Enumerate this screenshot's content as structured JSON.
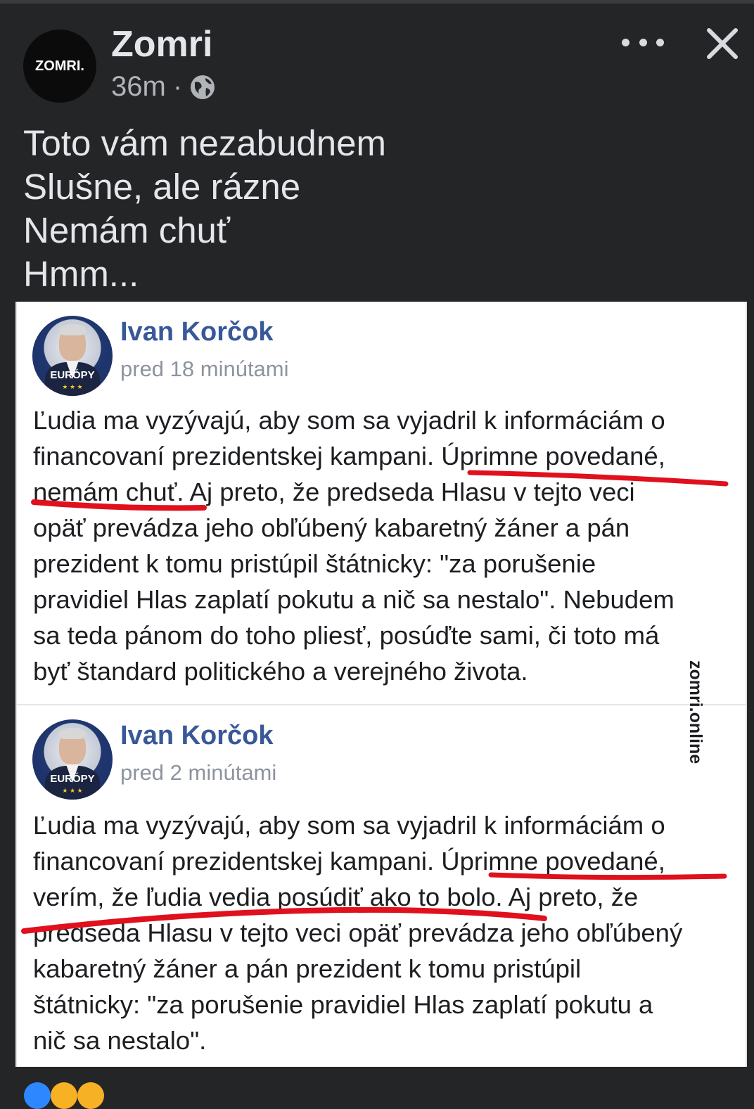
{
  "post": {
    "page_name": "Zomri",
    "avatar_text": "ZOMRI.",
    "time": "36m",
    "separator": "·",
    "privacy_icon": "globe-icon",
    "caption_lines": [
      "Toto vám nezabudnem",
      "Slušne, ale rázne",
      "Nemám chuť",
      "Hmm..."
    ]
  },
  "screenshot": {
    "watermark": "zomri.online",
    "posts": [
      {
        "author": "Ivan Korčok",
        "avatar_badge": "EURÓPY",
        "time": "pred 18 minútami",
        "lines": [
          "Ľudia ma vyzývajú, aby som sa vyjadril k informáciám o",
          "financovaní prezidentskej kampani. Úprimne povedané,",
          "nemám chuť. Aj preto, že predseda Hlasu v tejto veci",
          "opäť prevádza jeho obľúbený kabaretný žáner a pán",
          "prezident k tomu pristúpil štátnicky: \"za porušenie",
          "pravidiel Hlas zaplatí pokutu a nič sa nestalo\". Nebudem",
          "sa teda pánom do toho pliesť, posúďte sami, či toto má",
          "byť štandard politického a verejného života."
        ]
      },
      {
        "author": "Ivan Korčok",
        "avatar_badge": "EURÓPY",
        "time": "pred 2 minútami",
        "lines": [
          "Ľudia ma vyzývajú, aby som sa vyjadril k informáciám o",
          "financovaní prezidentskej kampani. Úprimne povedané,",
          "verím, že ľudia vedia posúdiť ako to bolo. Aj preto, že",
          "predseda Hlasu v tejto veci opäť prevádza jeho obľúbený",
          "kabaretný žáner a pán prezident k tomu pristúpil",
          "štátnicky: \"za porušenie pravidiel Hlas zaplatí pokutu a",
          "nič sa nestalo\"."
        ]
      }
    ]
  },
  "colors": {
    "dark_bg": "#242526",
    "link_blue": "#385898",
    "highlight_red": "#e0101c"
  }
}
